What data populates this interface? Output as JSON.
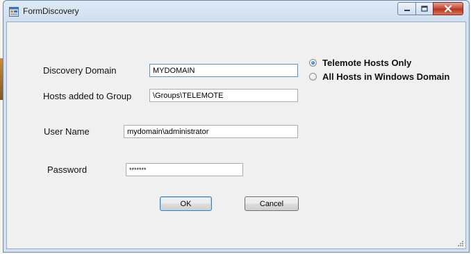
{
  "window": {
    "title": "FormDiscovery"
  },
  "form": {
    "discovery_domain": {
      "label": "Discovery Domain",
      "value": "MYDOMAIN"
    },
    "hosts_group": {
      "label": "Hosts added to Group",
      "value": "\\Groups\\TELEMOTE"
    },
    "user_name": {
      "label": "User Name",
      "value": "mydomain\\administrator"
    },
    "password": {
      "label": "Password",
      "value": "*******"
    },
    "scope_options": [
      {
        "label": "Telemote Hosts Only",
        "selected": true
      },
      {
        "label": "All Hosts in Windows Domain",
        "selected": false
      }
    ],
    "ok_label": "OK",
    "cancel_label": "Cancel"
  },
  "colors": {
    "accent": "#3c7fb1",
    "close_button": "#c7442e"
  },
  "icons": [
    "form-app-icon",
    "minimize-icon",
    "maximize-icon",
    "close-icon",
    "size-grip-icon"
  ]
}
